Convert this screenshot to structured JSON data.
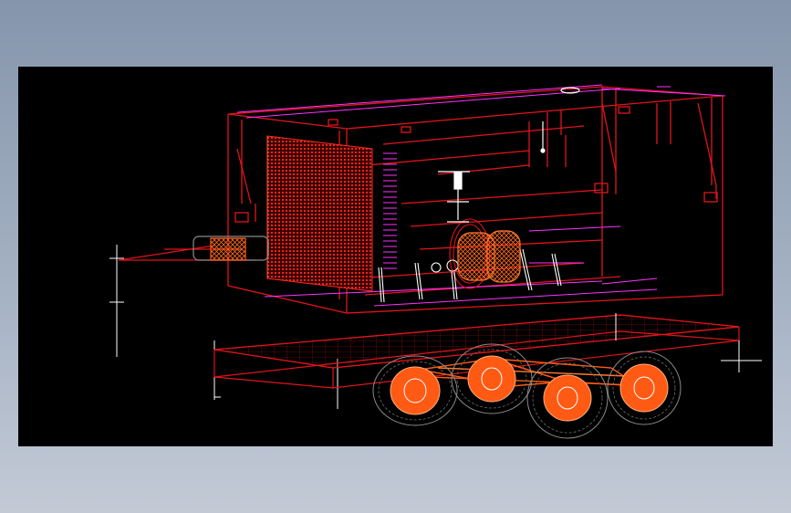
{
  "viewport": {
    "background": "#000000",
    "content": "wireframe-3d-trailer-generator-model"
  },
  "colors": {
    "frame_red": "#e0151b",
    "accent_magenta": "#ff32ff",
    "wheel_orange": "#ff5a14",
    "wire_grey": "#8a8a8a",
    "white_line": "#ffffff",
    "page_top": "#8595ab",
    "page_bottom": "#c3cad6"
  }
}
